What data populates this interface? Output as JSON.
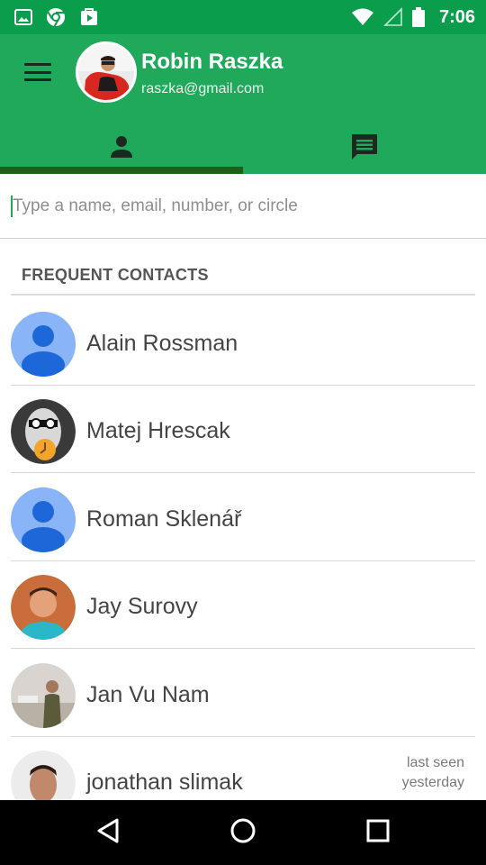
{
  "status_bar": {
    "time": "7:06",
    "left_icons": [
      "image-icon",
      "chrome-icon",
      "play-store-icon"
    ],
    "right_icons": [
      "wifi-icon",
      "signal-icon",
      "battery-icon"
    ]
  },
  "profile": {
    "name": "Robin Raszka",
    "email": "raszka@gmail.com"
  },
  "tabs": [
    {
      "icon": "person-icon",
      "selected": true
    },
    {
      "icon": "chat-icon",
      "selected": false
    }
  ],
  "search": {
    "placeholder": "Type a name, email, number, or circle",
    "value": ""
  },
  "section": {
    "title": "FREQUENT CONTACTS"
  },
  "contacts": [
    {
      "name": "Alain Rossman",
      "avatar": "default"
    },
    {
      "name": "Matej Hrescak",
      "avatar": "photo"
    },
    {
      "name": "Roman Sklenář",
      "avatar": "default"
    },
    {
      "name": "Jay Surovy",
      "avatar": "photo"
    },
    {
      "name": "Jan Vu Nam",
      "avatar": "photo"
    },
    {
      "name": "jonathan slimak",
      "avatar": "photo",
      "meta_line1": "last seen",
      "meta_line2": "yesterday"
    }
  ],
  "colors": {
    "status_bar": "#0a9d4c",
    "app_bar": "#20a95a",
    "tab_indicator": "#1e5e18",
    "default_avatar": "#8ab4f8"
  }
}
